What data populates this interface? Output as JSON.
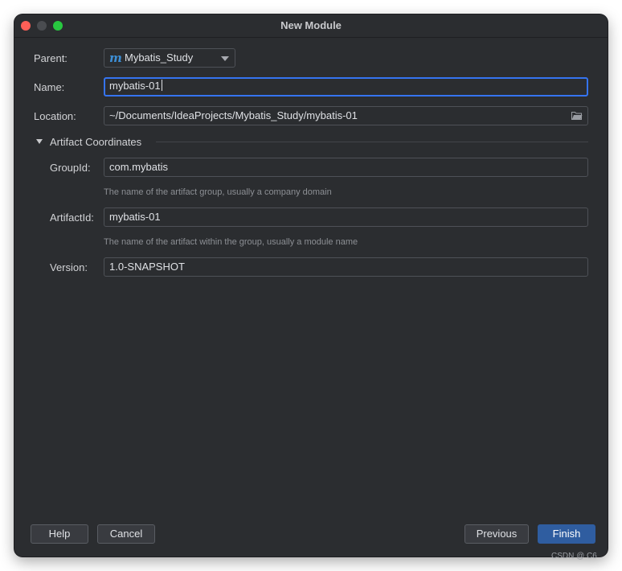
{
  "window": {
    "title": "New Module"
  },
  "form": {
    "parent": {
      "label": "Parent:",
      "value": "Mybatis_Study",
      "icon": "maven-m-icon"
    },
    "name": {
      "label": "Name:",
      "value": "mybatis-01"
    },
    "location": {
      "label": "Location:",
      "value": "~/Documents/IdeaProjects/Mybatis_Study/mybatis-01",
      "icon": "folder-icon"
    }
  },
  "artifact": {
    "section_label": "Artifact Coordinates",
    "group_id": {
      "label": "GroupId:",
      "value": "com.mybatis",
      "hint": "The name of the artifact group, usually a company domain"
    },
    "artifact_id": {
      "label": "ArtifactId:",
      "value": "mybatis-01",
      "hint": "The name of the artifact within the group, usually a module name"
    },
    "version": {
      "label": "Version:",
      "value": "1.0-SNAPSHOT"
    }
  },
  "buttons": {
    "help": "Help",
    "cancel": "Cancel",
    "previous": "Previous",
    "finish": "Finish"
  },
  "watermark": "CSDN @ C6",
  "colors": {
    "window_bg": "#2b2d30",
    "focus_border": "#3574f0",
    "primary_button": "#2f5da0",
    "close": "#ff5f57",
    "maximize": "#28c840"
  }
}
